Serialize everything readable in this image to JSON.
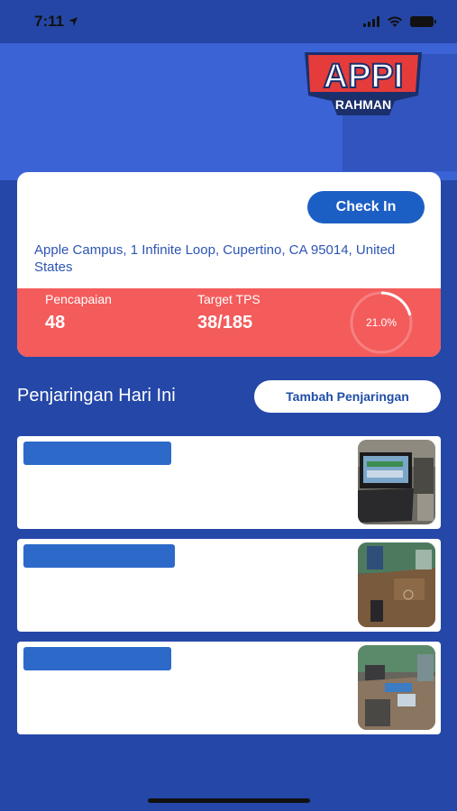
{
  "status_bar": {
    "time": "7:11"
  },
  "logo": {
    "line1": "APPI",
    "line2": "RAHMAN"
  },
  "location_card": {
    "checkin_label": "Check In",
    "address": "Apple Campus, 1 Infinite Loop, Cupertino, CA 95014, United States",
    "pencapaian_label": "Pencapaian",
    "pencapaian_value": "48",
    "target_label": "Target TPS",
    "target_value": "38/185",
    "progress_text": "21.0%",
    "progress_fraction": 0.21
  },
  "section": {
    "title": "Penjaringan Hari Ini",
    "add_button_label": "Tambah Penjaringan"
  },
  "colors": {
    "background": "#2547a8",
    "accent_blue": "#1c5fc4",
    "stats_red": "#f45b5b",
    "address_text": "#2d55b4"
  }
}
